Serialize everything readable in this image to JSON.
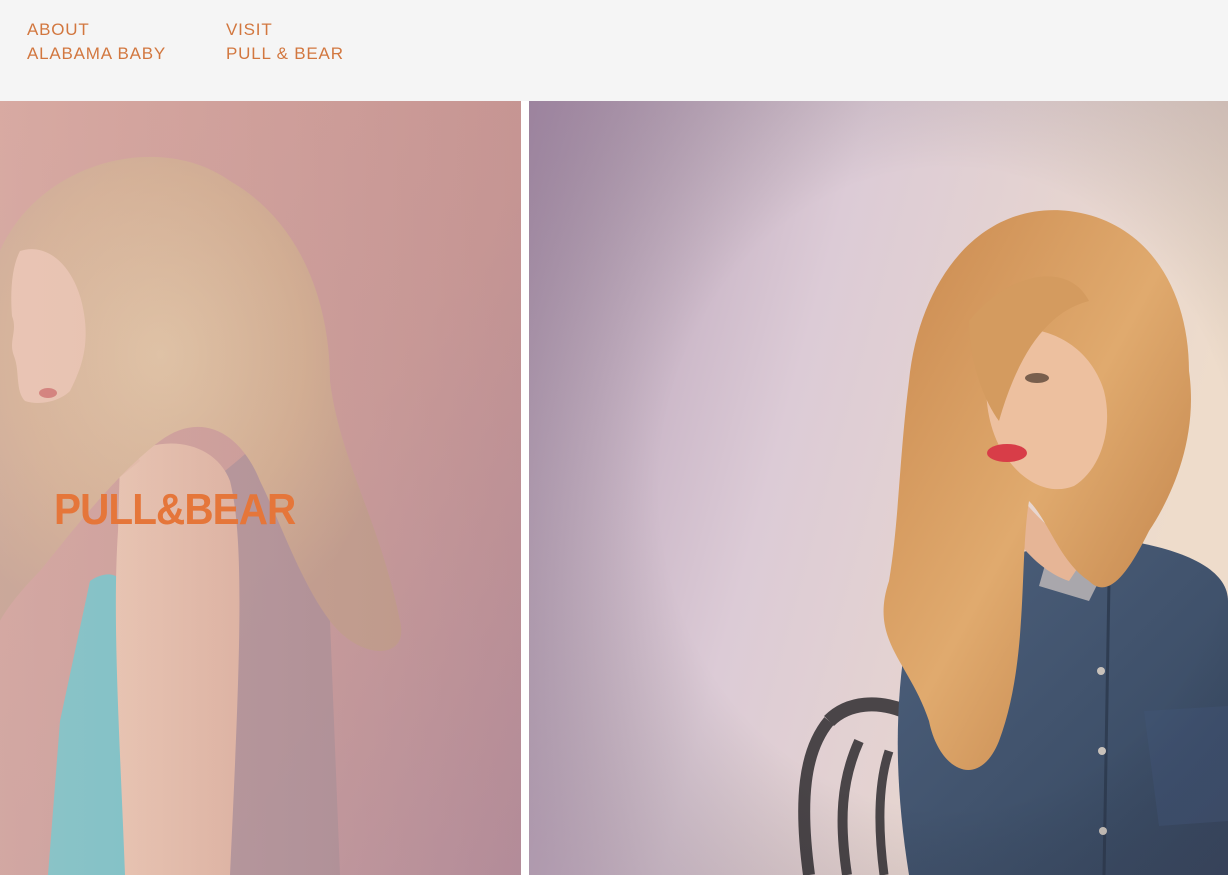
{
  "nav": {
    "about_label": "ABOUT",
    "alabama_label": "ALABAMA BABY",
    "visit_label": "VISIT",
    "pullbear_label": "PULL & BEAR"
  },
  "hero_left": {
    "logo_text": "PULL&BEAR"
  },
  "colors": {
    "accent": "#d2773f",
    "header_bg": "#f5f5f5"
  }
}
